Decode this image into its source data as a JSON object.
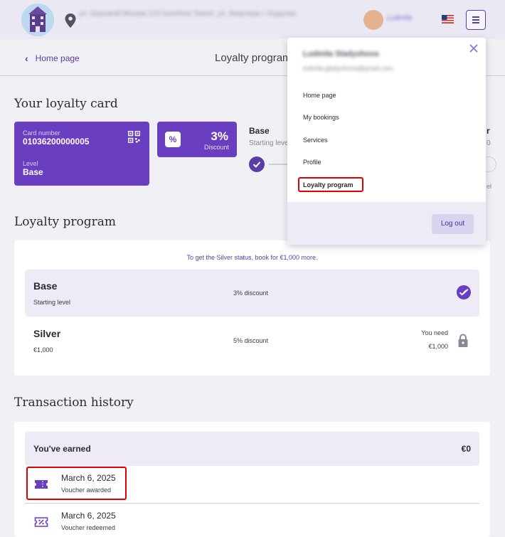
{
  "header": {
    "address_text": "ул. Шаховой.Москва 123 Sunshine Sweet. ул. Квартира г. Кодынка",
    "user_name": "Ludmila",
    "menu_icon": "hamburger-icon",
    "location_icon": "map-pin-icon",
    "language_flag": "us-flag-icon"
  },
  "subheader": {
    "back_label": "Home page",
    "page_title": "Loyalty program"
  },
  "loyalty_card": {
    "heading": "Your loyalty card",
    "card_number_label": "Card number",
    "card_number": "01036200000005",
    "level_label": "Level",
    "level": "Base",
    "discount_value": "3%",
    "discount_label": "Discount",
    "discount_icon_text": "%",
    "step_name": "Base",
    "step_sub": "Starting level",
    "edge_name_partial": "r",
    "edge_sub_partial": "0",
    "edge_bottom_partial": "el"
  },
  "loyalty_program": {
    "heading": "Loyalty program",
    "hint": "To get the Silver status, book for €1,000 more.",
    "tiers": [
      {
        "name": "Base",
        "sub": "Starting level",
        "discount": "3% discount",
        "achieved": true
      },
      {
        "name": "Silver",
        "sub": "€1,000",
        "discount": "5% discount",
        "need_label": "You need",
        "need_value": "€1,000",
        "achieved": false
      }
    ]
  },
  "transactions": {
    "heading": "Transaction history",
    "earned_label": "You've earned",
    "earned_value": "€0",
    "items": [
      {
        "date": "March 6, 2025",
        "desc": "Voucher awarded",
        "icon": "ticket-icon"
      },
      {
        "date": "March 6, 2025",
        "desc": "Voucher redeemed",
        "icon": "voucher-percent-icon"
      }
    ]
  },
  "dropdown": {
    "user_name": "Ludmila Sladyshova",
    "user_email": "ludmila.gladyshova@gmail.com",
    "items": [
      "Home page",
      "My bookings",
      "Services",
      "Profile",
      "Loyalty program"
    ],
    "selected_index": 4,
    "logout_label": "Log out"
  },
  "colors": {
    "brand": "#6a3ec0",
    "link": "#5a3ea8",
    "page_bg": "#f1f0f5",
    "highlight": "#e00000"
  }
}
